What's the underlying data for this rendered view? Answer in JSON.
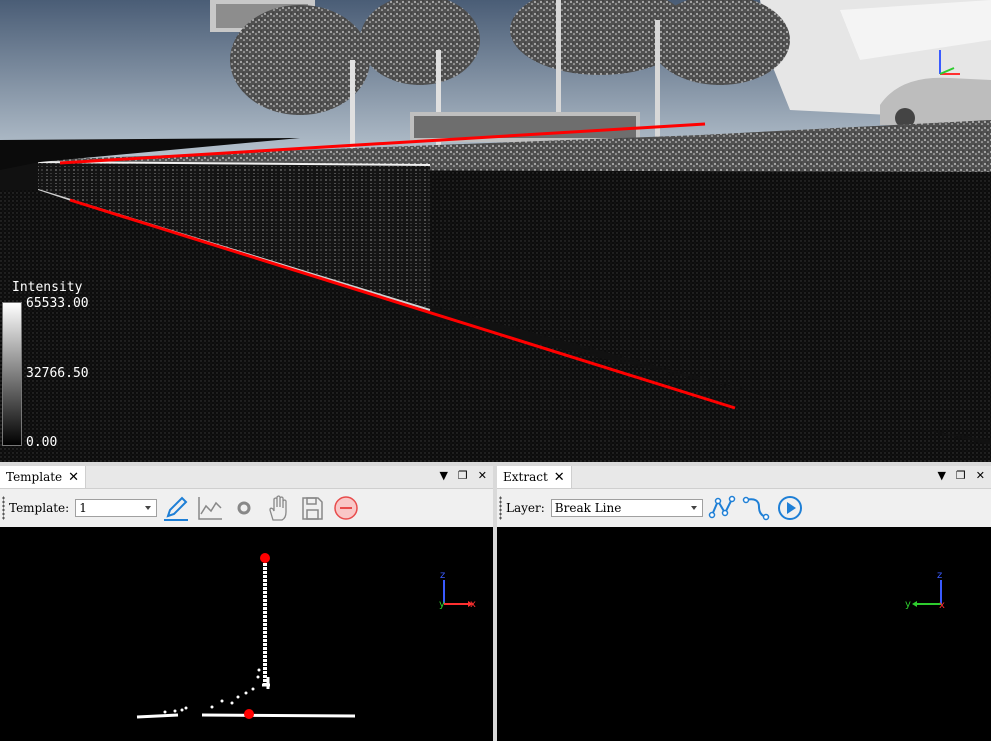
{
  "viewer": {
    "legend": {
      "title": "Intensity",
      "max": "65533.00",
      "mid": "32766.50",
      "min": "0.00"
    },
    "break_line_color": "#ff0000"
  },
  "template_panel": {
    "tab_label": "Template",
    "close_glyph": "✕",
    "menu_glyph": "▼",
    "float_glyph": "❐",
    "toolbar": {
      "template_label": "Template:",
      "template_value": "1",
      "icons": [
        "pencil-icon",
        "profile-chart-icon",
        "circle-icon",
        "hand-icon",
        "save-icon",
        "remove-icon"
      ]
    },
    "axis": {
      "z": "z",
      "y": "y",
      "x": "x"
    }
  },
  "extract_panel": {
    "tab_label": "Extract",
    "close_glyph": "✕",
    "menu_glyph": "▼",
    "float_glyph": "❐",
    "toolbar": {
      "layer_label": "Layer:",
      "layer_value": "Break Line",
      "icons": [
        "polyline-icon",
        "curve-icon",
        "play-icon"
      ]
    },
    "axis": {
      "z": "z",
      "y": "y",
      "x": "x"
    }
  },
  "colors": {
    "accent_blue": "#1e7fd6",
    "remove_red": "#e84c4c",
    "point_red": "#ff0000"
  }
}
